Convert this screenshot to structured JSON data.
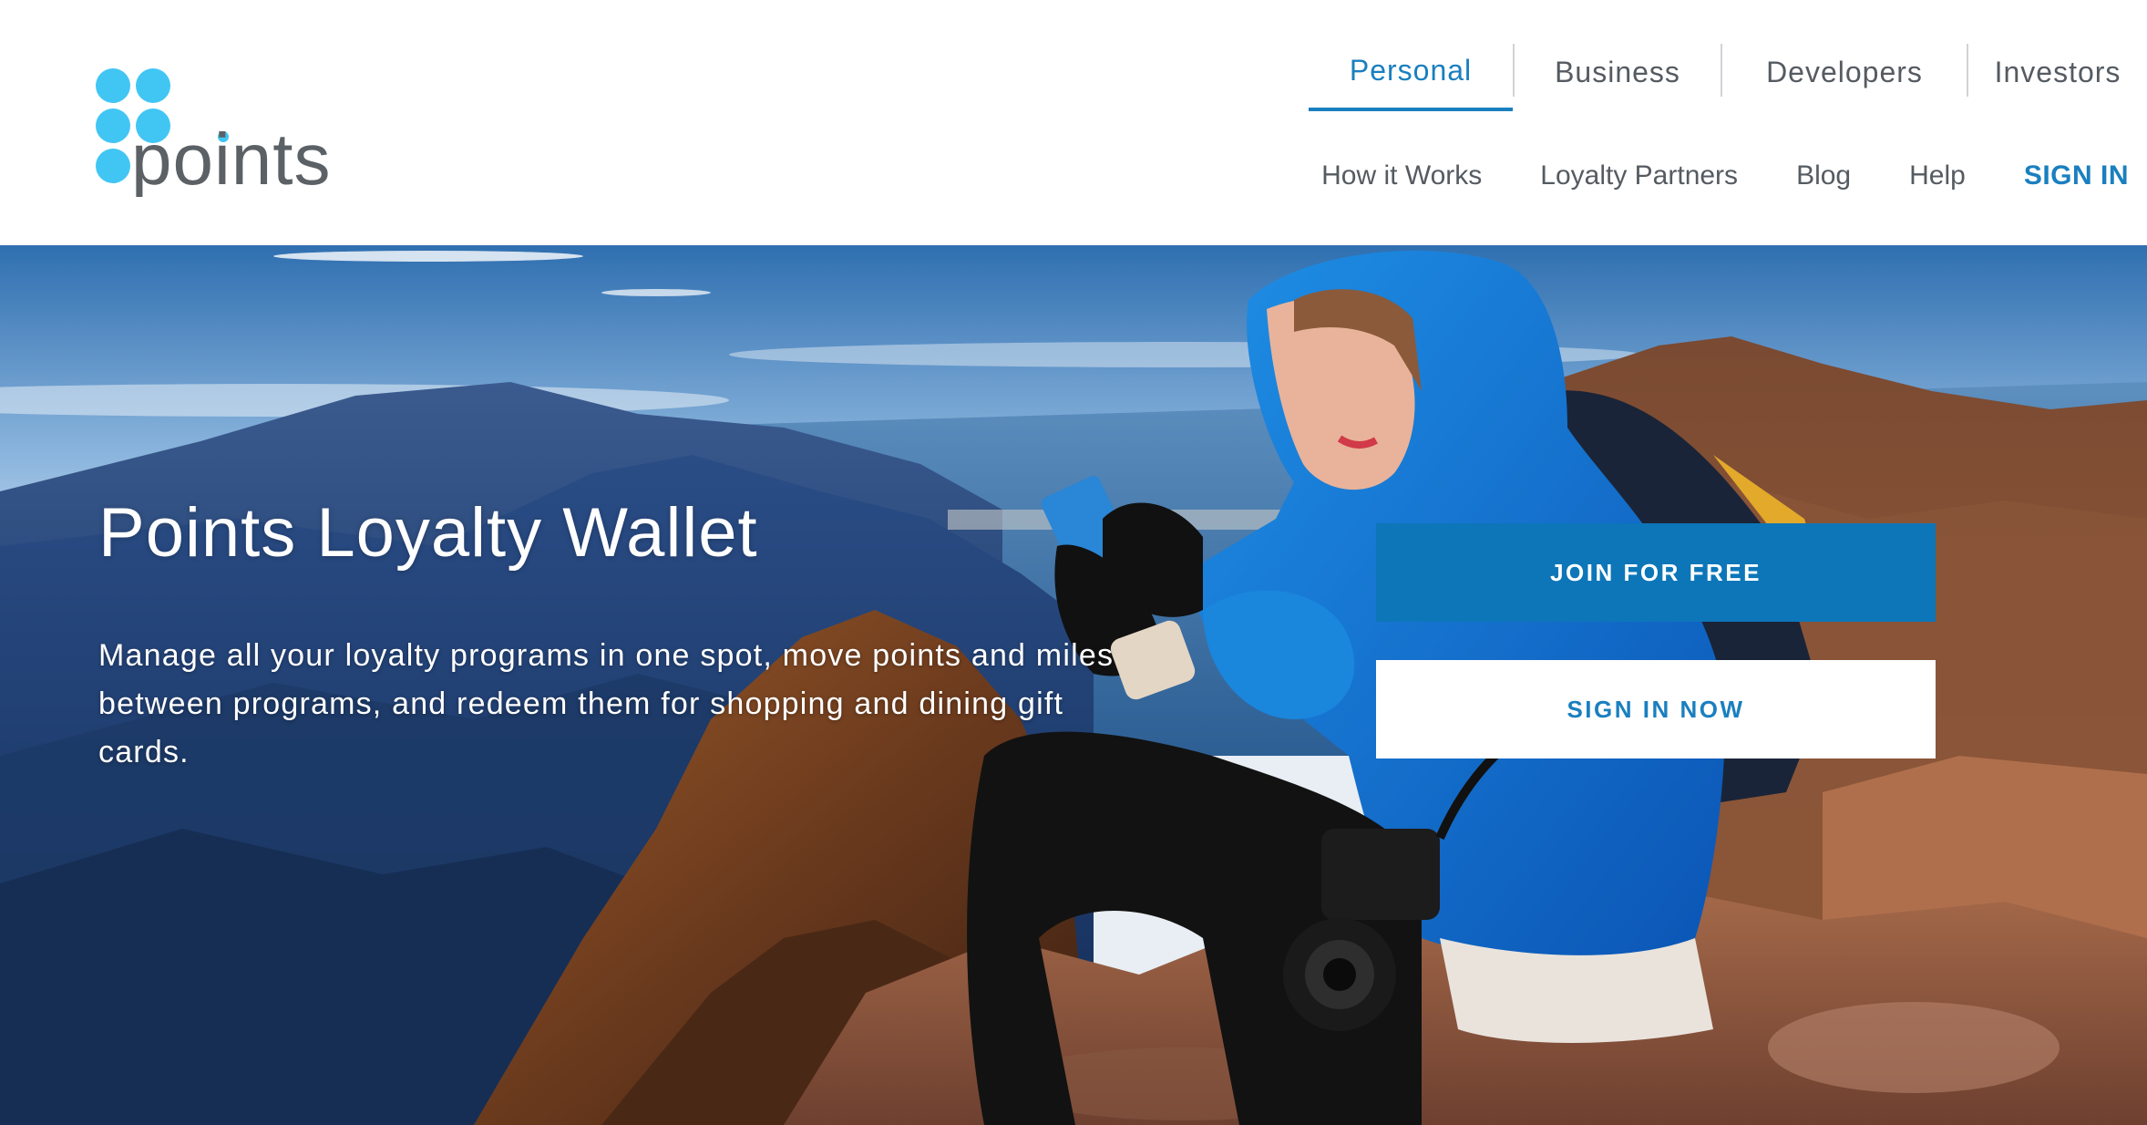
{
  "brand": {
    "logo_text": "points",
    "accent_color": "#1a7fbf",
    "logo_dot_color": "#41c6f4"
  },
  "top_tabs": [
    {
      "label": "Personal",
      "active": true
    },
    {
      "label": "Business",
      "active": false
    },
    {
      "label": "Developers",
      "active": false
    },
    {
      "label": "Investors",
      "active": false
    }
  ],
  "sub_nav": {
    "items": [
      "How it Works",
      "Loyalty Partners",
      "Blog",
      "Help"
    ],
    "sign_in": "SIGN IN"
  },
  "hero": {
    "title": "Points Loyalty Wallet",
    "description": "Manage all your loyalty programs in one spot, move points and miles between programs, and redeem them for shopping and dining gift cards.",
    "join_button": "JOIN FOR FREE",
    "sign_in_button": "SIGN IN NOW"
  }
}
